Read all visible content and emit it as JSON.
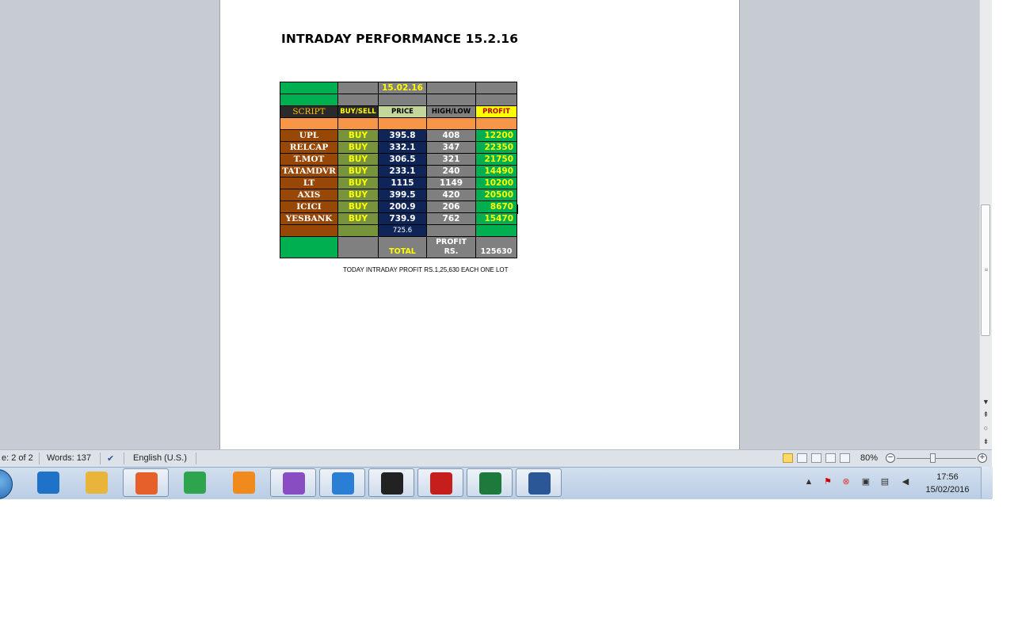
{
  "document": {
    "title": "INTRADAY PERFORMANCE 15.2.16",
    "table": {
      "date": "15.02.16",
      "headers": [
        "SCRIPT",
        "BUY/SELL",
        "PRICE",
        "HIGH/LOW",
        "PROFIT"
      ],
      "rows": [
        {
          "script": "UPL",
          "action": "BUY",
          "price": "395.8",
          "highlow": "408",
          "profit": "12200"
        },
        {
          "script": "RELCAP",
          "action": "BUY",
          "price": "332.1",
          "highlow": "347",
          "profit": "22350"
        },
        {
          "script": "T.MOT",
          "action": "BUY",
          "price": "306.5",
          "highlow": "321",
          "profit": "21750"
        },
        {
          "script": "TATAMDVR",
          "action": "BUY",
          "price": "233.1",
          "highlow": "240",
          "profit": "14490"
        },
        {
          "script": "LT",
          "action": "BUY",
          "price": "1115",
          "highlow": "1149",
          "profit": "10200"
        },
        {
          "script": "AXIS",
          "action": "BUY",
          "price": "399.5",
          "highlow": "420",
          "profit": "20500"
        },
        {
          "script": "ICICI",
          "action": "BUY",
          "price": "200.9",
          "highlow": "206",
          "profit": "8670"
        },
        {
          "script": "YESBANK",
          "action": "BUY",
          "price": "739.9",
          "highlow": "762",
          "profit": "15470"
        }
      ],
      "extra_price": "725.6",
      "total_label": "TOTAL",
      "profit_label_1": "PROFIT",
      "profit_label_2": "RS.",
      "total_profit": "125630"
    },
    "caption": "TODAY INTRADAY PROFIT RS.1,25,630 EACH ONE LOT"
  },
  "statusbar": {
    "page": "e: 2 of 2",
    "words": "Words: 137",
    "language": "English (U.S.)",
    "zoom": "80%",
    "zoom_fraction": 0.45
  },
  "taskbar": {
    "time": "17:56",
    "date": "15/02/2016",
    "apps": [
      {
        "name": "internet-explorer",
        "color": "#1e73c8"
      },
      {
        "name": "file-explorer",
        "color": "#e8b53a"
      },
      {
        "name": "firefox",
        "color": "#e5602a"
      },
      {
        "name": "chrome",
        "color": "#2ea44f"
      },
      {
        "name": "media-player",
        "color": "#f08a1c"
      },
      {
        "name": "messenger",
        "color": "#8a4cc2"
      },
      {
        "name": "puzzle-app",
        "color": "#2a7fd4"
      },
      {
        "name": "stock-chart-app",
        "color": "#222222"
      },
      {
        "name": "bull-app",
        "color": "#c61d1d"
      },
      {
        "name": "excel",
        "color": "#1d7a3c"
      },
      {
        "name": "word",
        "color": "#2b5797"
      }
    ]
  }
}
